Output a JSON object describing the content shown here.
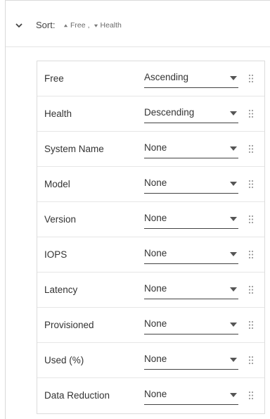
{
  "sort_panel": {
    "label": "Sort:",
    "summary": [
      {
        "field": "Free",
        "direction_icon": "arrow-up-icon"
      },
      {
        "field": "Health",
        "direction_icon": "arrow-down-icon"
      }
    ],
    "separator": ",",
    "expand_icon": "chevron-down-icon",
    "rows": [
      {
        "label": "Free",
        "value": "Ascending"
      },
      {
        "label": "Health",
        "value": "Descending"
      },
      {
        "label": "System Name",
        "value": "None"
      },
      {
        "label": "Model",
        "value": "None"
      },
      {
        "label": "Version",
        "value": "None"
      },
      {
        "label": "IOPS",
        "value": "None"
      },
      {
        "label": "Latency",
        "value": "None"
      },
      {
        "label": "Provisioned",
        "value": "None"
      },
      {
        "label": "Used (%)",
        "value": "None"
      },
      {
        "label": "Data Reduction",
        "value": "None"
      }
    ]
  },
  "colors": {
    "text": "#333333",
    "muted": "#6b6b6b",
    "border": "#dcdcdc",
    "underline": "#444444"
  }
}
